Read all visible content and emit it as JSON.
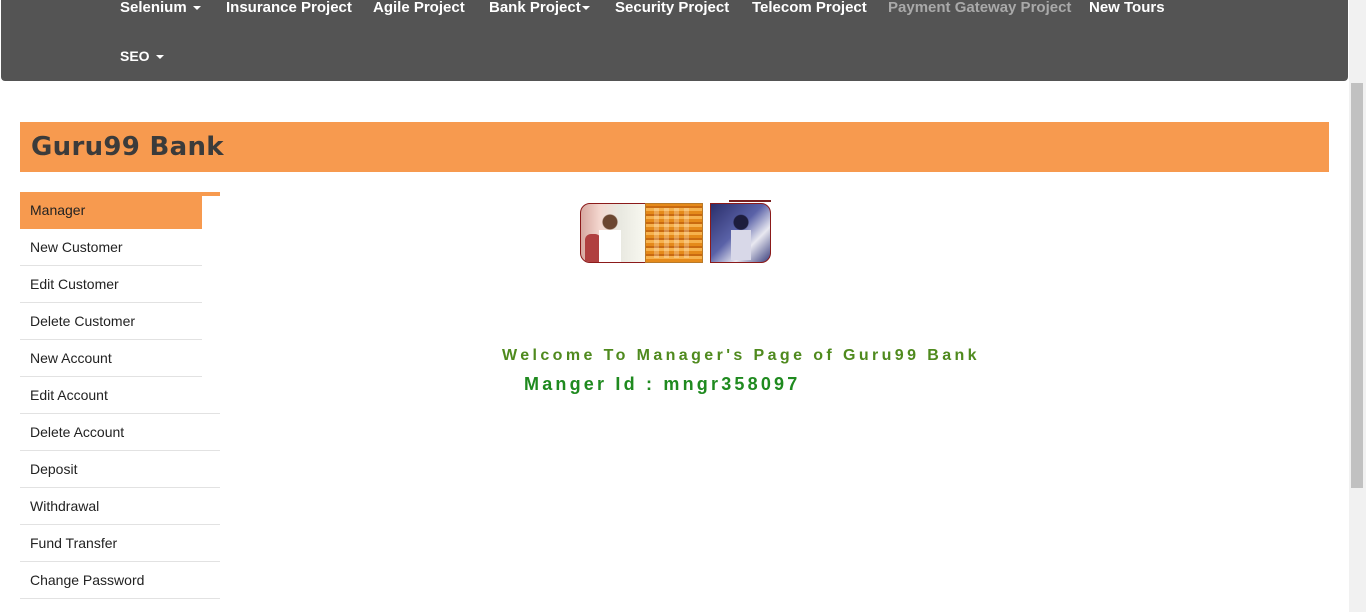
{
  "navbar": {
    "items": [
      {
        "label": "Selenium",
        "dropdown": true
      },
      {
        "label": "Insurance Project",
        "dropdown": false
      },
      {
        "label": "Agile Project",
        "dropdown": false
      },
      {
        "label": "Bank Project",
        "dropdown": true
      },
      {
        "label": "Security Project",
        "dropdown": false
      },
      {
        "label": "Telecom Project",
        "dropdown": false
      },
      {
        "label": "Payment Gateway Project",
        "dropdown": false
      },
      {
        "label": "New Tours",
        "dropdown": false
      },
      {
        "label": "SEO",
        "dropdown": true
      }
    ]
  },
  "banner": {
    "title": "Guru99 Bank"
  },
  "sidebar": {
    "items": [
      {
        "label": "Manager",
        "active": true
      },
      {
        "label": "New Customer"
      },
      {
        "label": "Edit Customer"
      },
      {
        "label": "Delete Customer"
      },
      {
        "label": "New Account"
      },
      {
        "label": "Edit Account"
      },
      {
        "label": "Delete Account"
      },
      {
        "label": "Deposit"
      },
      {
        "label": "Withdrawal"
      },
      {
        "label": "Fund Transfer"
      },
      {
        "label": "Change Password"
      }
    ]
  },
  "main": {
    "welcome": "Welcome To Manager's Page of Guru99 Bank",
    "manager_id": "Manger Id : mngr358097"
  },
  "colors": {
    "navbar": "#545454",
    "accent": "#f79a4f",
    "welcome_text": "#4f8a1e",
    "manager_id_text": "#1f8a1f"
  }
}
